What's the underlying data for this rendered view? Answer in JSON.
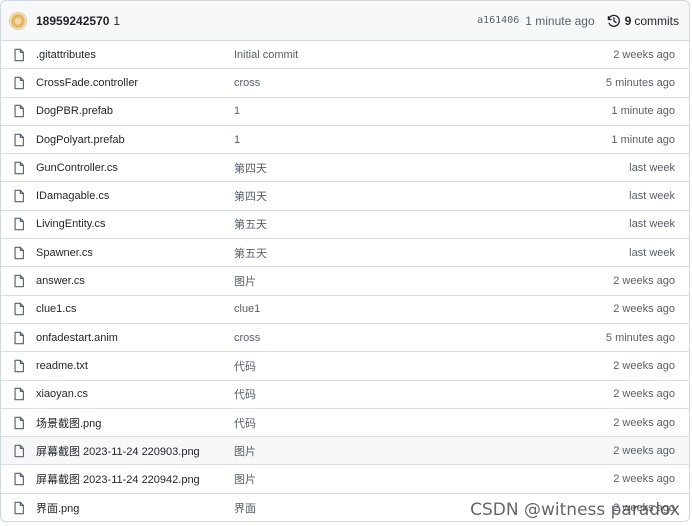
{
  "latest_commit": {
    "author": "18959242570",
    "message": "1",
    "sha": "a161406",
    "time": "1 minute ago",
    "commits_count": "9",
    "commits_label": "commits",
    "avatar_icon": "user-avatar"
  },
  "files": [
    {
      "name": ".gitattributes",
      "message": "Initial commit",
      "time": "2 weeks ago",
      "icon": "file-icon"
    },
    {
      "name": "CrossFade.controller",
      "message": "cross",
      "time": "5 minutes ago",
      "icon": "file-icon"
    },
    {
      "name": "DogPBR.prefab",
      "message": "1",
      "time": "1 minute ago",
      "icon": "file-icon"
    },
    {
      "name": "DogPolyart.prefab",
      "message": "1",
      "time": "1 minute ago",
      "icon": "file-icon"
    },
    {
      "name": "GunController.cs",
      "message": "第四天",
      "time": "last week",
      "icon": "file-icon"
    },
    {
      "name": "IDamagable.cs",
      "message": "第四天",
      "time": "last week",
      "icon": "file-icon"
    },
    {
      "name": "LivingEntity.cs",
      "message": "第五天",
      "time": "last week",
      "icon": "file-icon"
    },
    {
      "name": "Spawner.cs",
      "message": "第五天",
      "time": "last week",
      "icon": "file-icon"
    },
    {
      "name": "answer.cs",
      "message": "图片",
      "time": "2 weeks ago",
      "icon": "file-icon"
    },
    {
      "name": "clue1.cs",
      "message": "clue1",
      "time": "2 weeks ago",
      "icon": "file-icon"
    },
    {
      "name": "onfadestart.anim",
      "message": "cross",
      "time": "5 minutes ago",
      "icon": "file-icon"
    },
    {
      "name": "readme.txt",
      "message": "代码",
      "time": "2 weeks ago",
      "icon": "file-icon"
    },
    {
      "name": "xiaoyan.cs",
      "message": "代码",
      "time": "2 weeks ago",
      "icon": "file-icon"
    },
    {
      "name": "场景截图.png",
      "message": "代码",
      "time": "2 weeks ago",
      "icon": "file-icon"
    },
    {
      "name": "屏幕截图 2023-11-24 220903.png",
      "message": "图片",
      "time": "2 weeks ago",
      "icon": "file-icon"
    },
    {
      "name": "屏幕截图 2023-11-24 220942.png",
      "message": "图片",
      "time": "2 weeks ago",
      "icon": "file-icon"
    },
    {
      "name": "界面.png",
      "message": "界面",
      "time": "2 weeks ago",
      "icon": "file-icon"
    }
  ],
  "watermark": "CSDN @witness paradox",
  "colors": {
    "border": "#d0d7de",
    "header_bg": "#f6f8fa",
    "muted_text": "#57606a",
    "text": "#1f2328"
  }
}
